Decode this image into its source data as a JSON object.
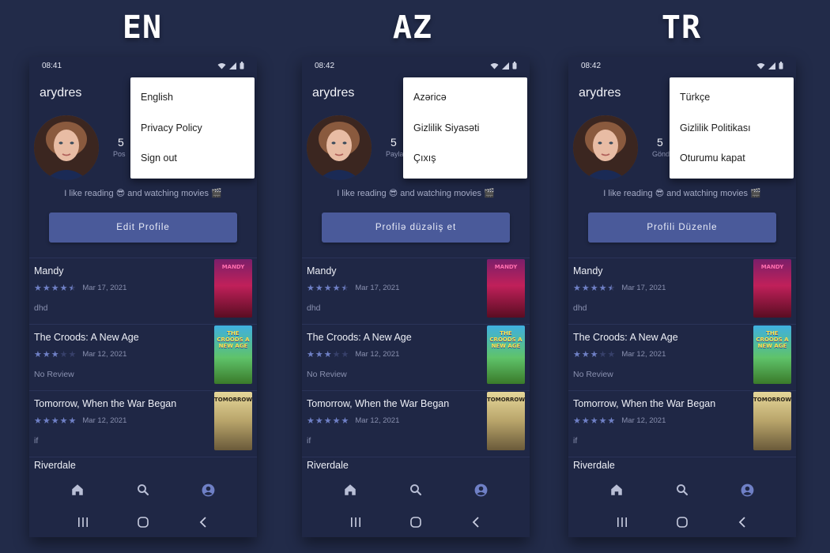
{
  "panels": [
    {
      "lang": "EN",
      "time": "08:41",
      "username": "arydres",
      "stat_num": "5",
      "stat_label": "Pos",
      "bio": "I like reading 😎 and watching movies 🎬",
      "edit_label": "Edit Profile",
      "menu": [
        "English",
        "Privacy Policy",
        "Sign out"
      ],
      "no_review": "No Review"
    },
    {
      "lang": "AZ",
      "time": "08:42",
      "username": "arydres",
      "stat_num": "5",
      "stat_label": "Payla",
      "bio": "I like reading 😎 and watching movies 🎬",
      "edit_label": "Profilə düzəliş et",
      "menu": [
        "Azəricə",
        "Gizlilik Siyasəti",
        "Çıxış"
      ],
      "no_review": "No Review"
    },
    {
      "lang": "TR",
      "time": "08:42",
      "username": "arydres",
      "stat_num": "5",
      "stat_label": "Gönd",
      "bio": "I like reading 😎 and watching movies 🎬",
      "edit_label": "Profili Düzenle",
      "menu": [
        "Türkçe",
        "Gizlilik Politikası",
        "Oturumu kapat"
      ],
      "no_review": "No Review"
    }
  ],
  "reviews": [
    {
      "title": "Mandy",
      "rating": 4.5,
      "date": "Mar 17, 2021",
      "text": "dhd",
      "poster_label": "MANDY",
      "poster_class": "p-mandy"
    },
    {
      "title": "The Croods: A New Age",
      "rating": 3,
      "date": "Mar 12, 2021",
      "text": "No Review",
      "poster_label": "THE CROODS A NEW AGE",
      "poster_class": "p-croods"
    },
    {
      "title": "Tomorrow, When the War Began",
      "rating": 5,
      "date": "Mar 12, 2021",
      "text": "if",
      "poster_label": "TOMORROW",
      "poster_class": "p-tomorrow"
    }
  ],
  "partial_title": "Riverdale",
  "colors": {
    "background": "#222b49",
    "phone_bg": "#1f2745",
    "accent_button": "#4a5a9a",
    "star_on": "#6f80c6",
    "nav_active": "#6f80c6",
    "nav_inactive": "#b9bfd6"
  },
  "icons": {
    "nav": [
      "home-icon",
      "search-icon",
      "account-circle-icon"
    ],
    "system": [
      "recent-apps-icon",
      "home-circle-icon",
      "back-icon"
    ]
  }
}
